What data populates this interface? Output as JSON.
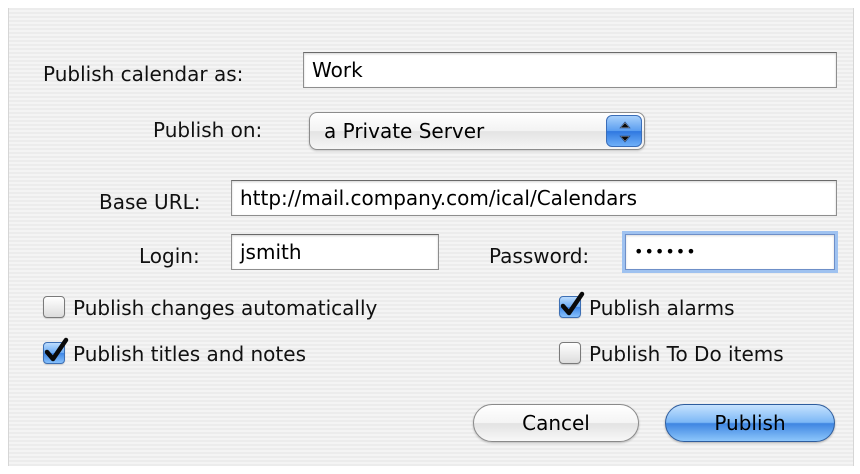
{
  "publish_as": {
    "label": "Publish calendar as:",
    "value": "Work"
  },
  "publish_on": {
    "label": "Publish on:",
    "selected": "a Private Server"
  },
  "base_url": {
    "label": "Base URL:",
    "value": "http://mail.company.com/ical/Calendars"
  },
  "login": {
    "label": "Login:",
    "value": "jsmith"
  },
  "password": {
    "label": "Password:",
    "value": "••••••"
  },
  "options": {
    "publish_changes": {
      "label": "Publish changes automatically",
      "checked": false
    },
    "publish_titles": {
      "label": "Publish titles and notes",
      "checked": true
    },
    "publish_alarms": {
      "label": "Publish alarms",
      "checked": true
    },
    "publish_todo": {
      "label": "Publish To Do items",
      "checked": false
    }
  },
  "buttons": {
    "cancel": "Cancel",
    "publish": "Publish"
  },
  "colors": {
    "accent_blue": "#3f86e2",
    "focus_ring": "#9fc2f0",
    "sheet_background": "#f0f0f0"
  },
  "icons": {
    "popup_arrows": "up-down-arrows-icon",
    "checkmark": "checkmark-icon"
  }
}
